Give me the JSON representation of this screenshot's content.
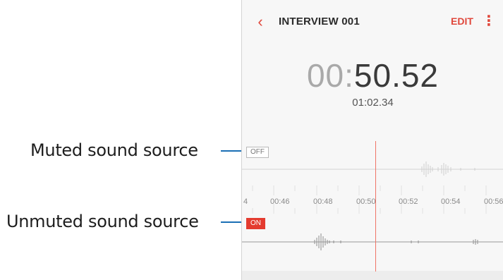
{
  "callouts": {
    "muted": "Muted sound source",
    "unmuted": "Unmuted sound source"
  },
  "appbar": {
    "back_icon": "chevron-left-icon",
    "title": "INTERVIEW 001",
    "edit_label": "EDIT",
    "more_icon": "more-vert-icon"
  },
  "recorder": {
    "elapsed_minutes": "00:",
    "elapsed_seconds": "50.52",
    "total_duration": "01:02.34"
  },
  "tracks": {
    "off_label": "OFF",
    "on_label": "ON",
    "time_ticks": [
      "4",
      "00:46",
      "00:48",
      "00:50",
      "00:52",
      "00:54",
      "00:56"
    ]
  },
  "colors": {
    "accent": "#e0483c",
    "callout_line": "#1a6fb5",
    "playhead": "#f07466"
  }
}
